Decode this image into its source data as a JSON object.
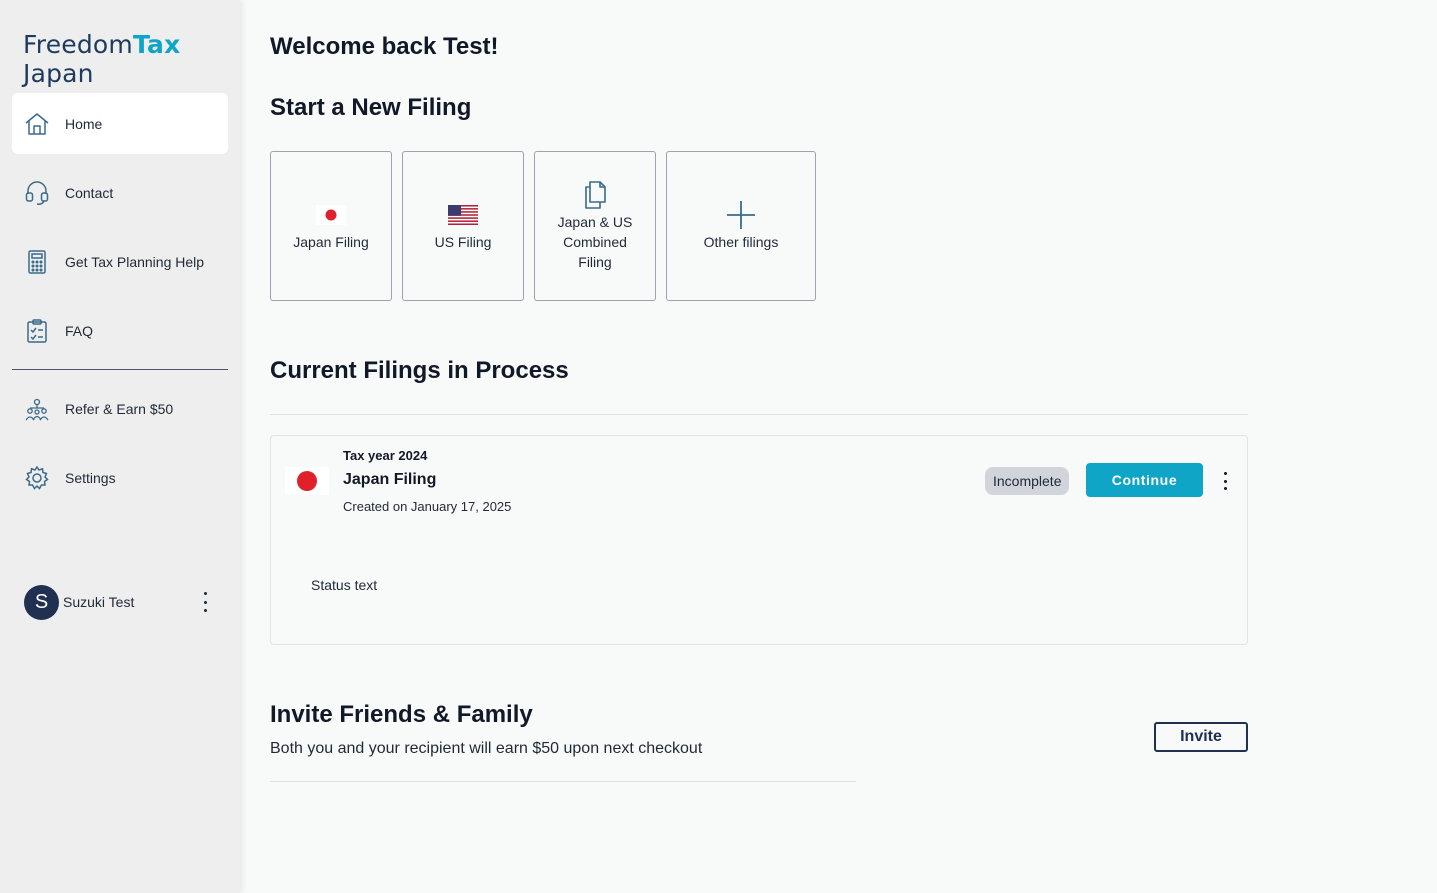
{
  "brand": {
    "part1": "Freedom",
    "part2": "Tax",
    "part3": " Japan"
  },
  "sidebar": {
    "items": [
      {
        "label": "Home",
        "icon": "home-icon"
      },
      {
        "label": "Contact",
        "icon": "headset-icon"
      },
      {
        "label": "Get Tax Planning Help",
        "icon": "calculator-icon"
      },
      {
        "label": "FAQ",
        "icon": "clipboard-check-icon"
      },
      {
        "label": "Refer & Earn $50",
        "icon": "people-network-icon"
      },
      {
        "label": "Settings",
        "icon": "gear-icon"
      }
    ],
    "user": {
      "initial": "S",
      "name": "Suzuki Test"
    }
  },
  "main": {
    "welcome": "Welcome back Test!",
    "new_filing_title": "Start a New Filing",
    "filing_options": [
      {
        "label": "Japan Filing",
        "icon": "japan-flag-icon"
      },
      {
        "label": "US Filing",
        "icon": "us-flag-icon"
      },
      {
        "label": "Japan & US Combined Filing",
        "icon": "documents-icon"
      },
      {
        "label": "Other filings",
        "icon": "plus-icon"
      }
    ],
    "current_title": "Current Filings in Process",
    "current_filing": {
      "tax_year": "Tax year 2024",
      "title": "Japan Filing",
      "created": "Created on January 17, 2025",
      "status_badge": "Incomplete",
      "continue_label": "Continue",
      "status_text": "Status text"
    },
    "invite": {
      "title": "Invite Friends & Family",
      "subtitle": "Both you and your recipient will earn $50 upon next checkout",
      "button": "Invite"
    }
  },
  "colors": {
    "accent": "#0ea5c6",
    "navy": "#1f3050",
    "japan_red": "#e0202a"
  }
}
